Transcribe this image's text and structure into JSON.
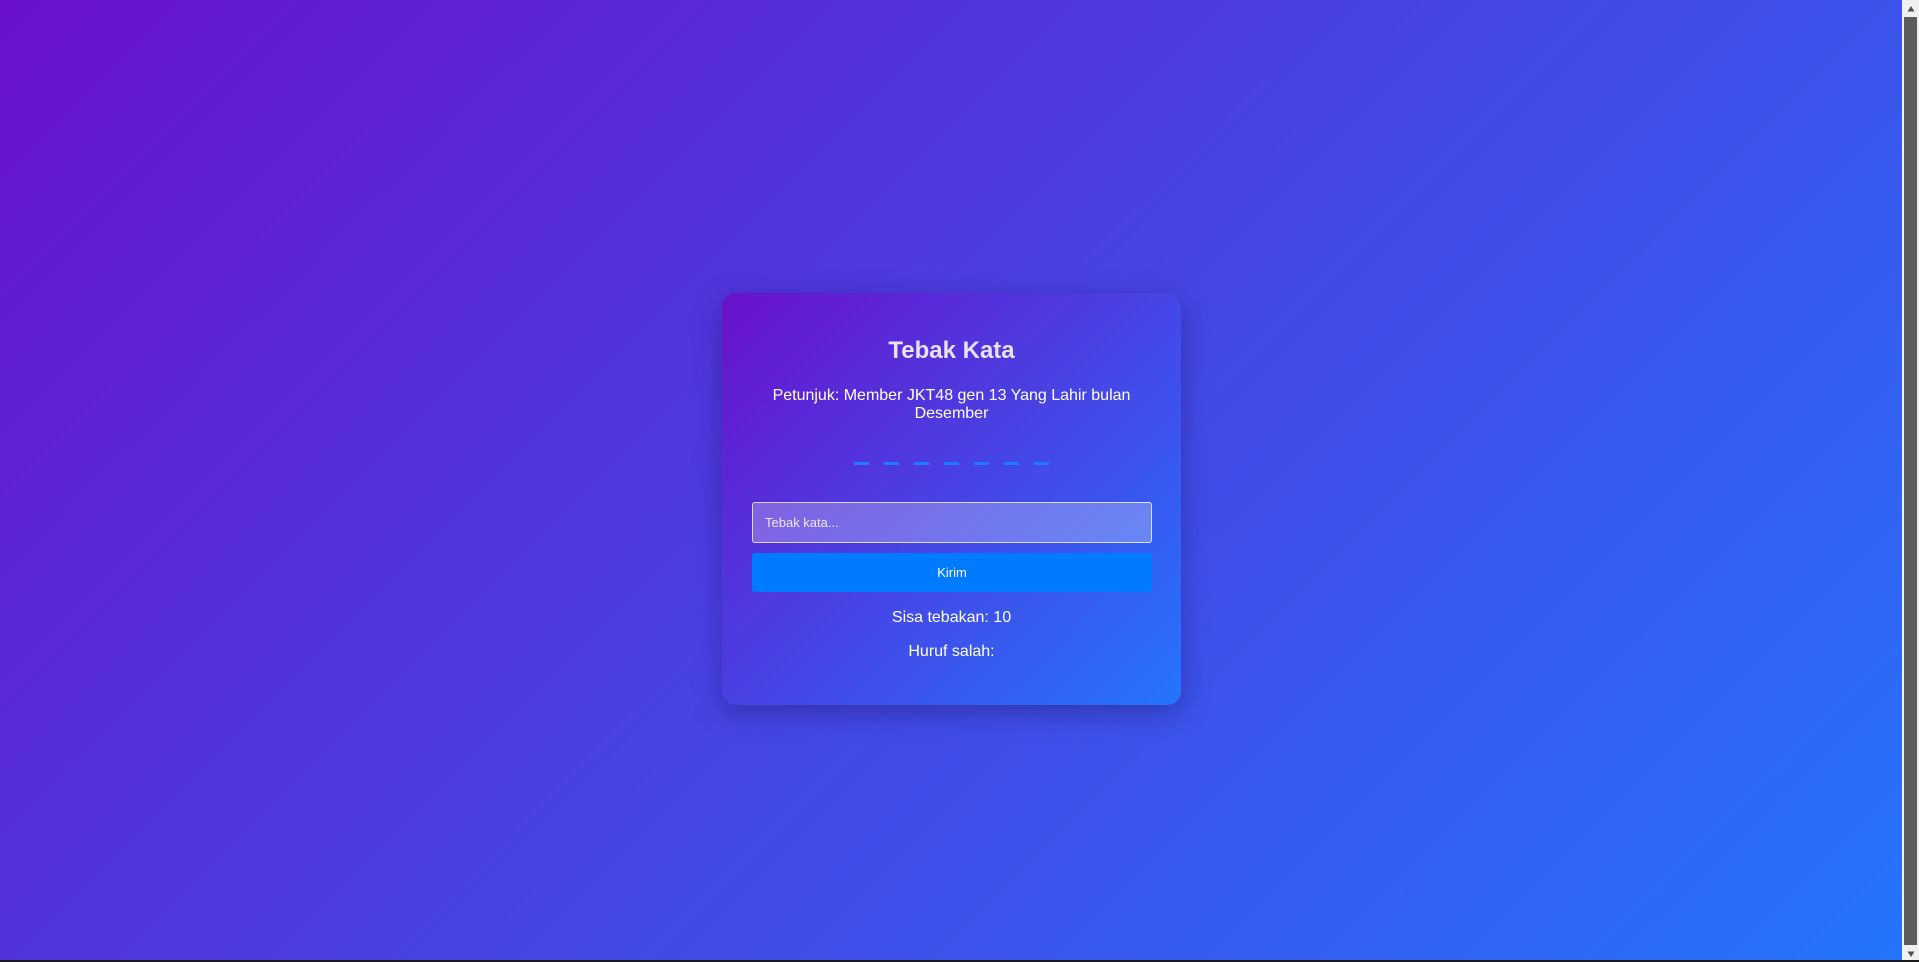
{
  "game": {
    "title": "Tebak Kata",
    "hint": "Petunjuk: Member JKT48 gen 13 Yang Lahir bulan Desember",
    "word_length": 7,
    "input_placeholder": "Tebak kata...",
    "input_value": "",
    "submit_label": "Kirim",
    "remaining_label": "Sisa tebakan:",
    "remaining_count": "10",
    "wrong_letters_label": "Huruf salah:",
    "wrong_letters": ""
  },
  "colors": {
    "background_start": "#6a11cb",
    "background_end": "#2575fc",
    "button": "#007bff",
    "blank": "#1e7bff"
  },
  "icons": {
    "scroll_up": "triangle-up-icon",
    "scroll_down": "triangle-down-icon"
  }
}
